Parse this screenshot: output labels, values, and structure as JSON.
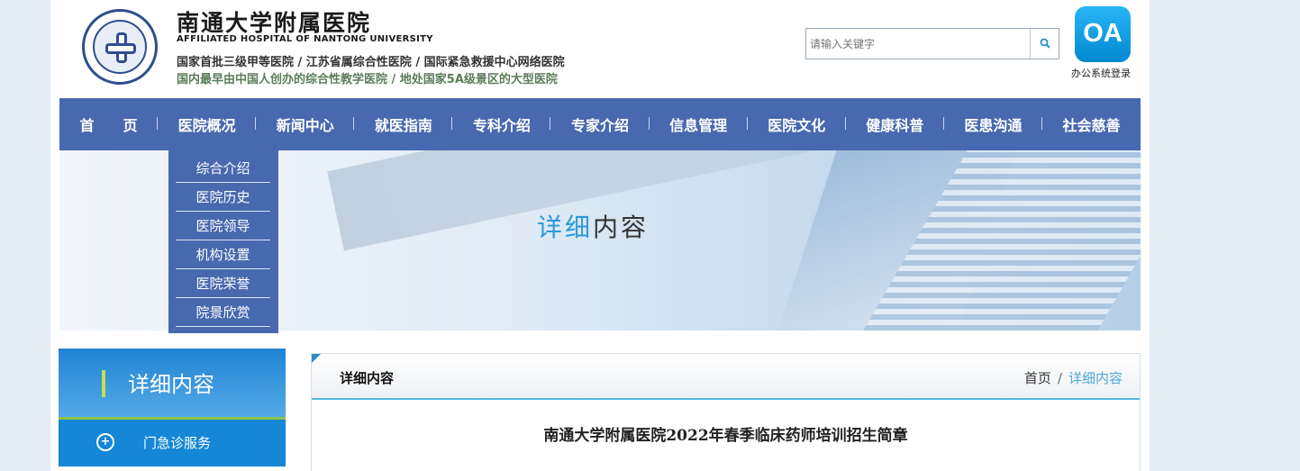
{
  "header": {
    "title": "南通大学附属医院",
    "title_en": "AFFILIATED HOSPITAL OF NANTONG UNIVERSITY",
    "tagline1": "国家首批三级甲等医院 / 江苏省属综合性医院 / 国际紧急救援中心网络医院",
    "tagline2": "国内最早由中国人创办的综合性教学医院 / 地处国家5A级景区的大型医院",
    "search_placeholder": "请输入关键字",
    "oa_icon_text": "OA",
    "oa_label": "办公系统登录"
  },
  "nav": {
    "items": [
      "首　　页",
      "医院概况",
      "新闻中心",
      "就医指南",
      "专科介绍",
      "专家介绍",
      "信息管理",
      "医院文化",
      "健康科普",
      "医患沟通",
      "社会慈善"
    ]
  },
  "dropdown": {
    "items": [
      "综合介绍",
      "医院历史",
      "医院领导",
      "机构设置",
      "医院荣誉",
      "院景欣赏"
    ]
  },
  "banner": {
    "title_part1": "详细",
    "title_part2": "内容"
  },
  "sidebar": {
    "heading": "详细内容",
    "items": [
      {
        "label": "门急诊服务",
        "icon": "plus-circle-icon"
      }
    ]
  },
  "content": {
    "header_title": "详细内容",
    "breadcrumb": {
      "home": "首页",
      "separator": "/",
      "current": "详细内容"
    },
    "article_title": "南通大学附属医院2022年春季临床药师培训招生简章"
  },
  "colors": {
    "nav_bg": "#4868b0",
    "sidebar_blue": "#1587d6",
    "accent_green": "#8bc34a",
    "breadcrumb_current": "#4ba6d8"
  }
}
